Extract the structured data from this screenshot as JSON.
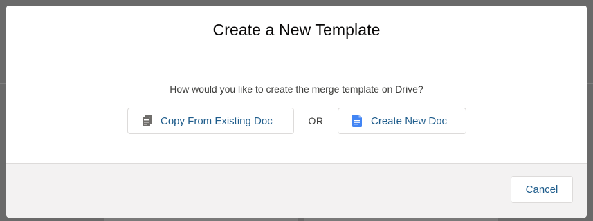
{
  "modal": {
    "title": "Create a New Template",
    "question": "How would you like to create the merge template on Drive?",
    "copy_button_label": "Copy From Existing Doc",
    "or_label": "OR",
    "create_button_label": "Create New Doc",
    "cancel_button_label": "Cancel"
  },
  "icons": {
    "copy": "copy-docs-icon",
    "create": "google-doc-icon"
  },
  "colors": {
    "overlay": "#6a6a6a",
    "link_blue": "#1f5d8c",
    "doc_blue": "#4285f4",
    "footer_bg": "#f3f2f2"
  }
}
